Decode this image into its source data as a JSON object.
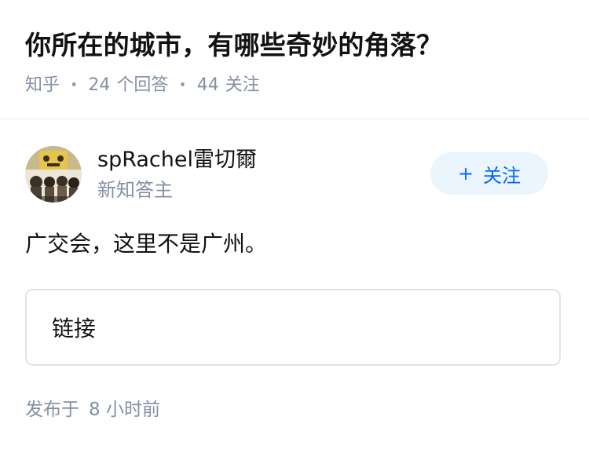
{
  "question": {
    "title": "你所在的城市，有哪些奇妙的角落？",
    "source": "知乎",
    "answer_count": "24",
    "answer_label": "个回答",
    "follow_count": "44",
    "follow_label": "关注",
    "separator": "·"
  },
  "author": {
    "name": "spRachel雷切爾",
    "badge": "新知答主",
    "follow_button_label": "关注",
    "follow_icon": "plus-icon",
    "avatar_icon": "avatar-image"
  },
  "answer": {
    "text": "广交会，这里不是广州。",
    "link_card_label": "链接"
  },
  "footer": {
    "published_label": "发布于",
    "published_time": "8 小时前"
  },
  "colors": {
    "title": "#121212",
    "meta": "#8590a6",
    "accent": "#0066ff",
    "follow_bg": "#ebf5fd",
    "border": "#e3e3e3"
  }
}
